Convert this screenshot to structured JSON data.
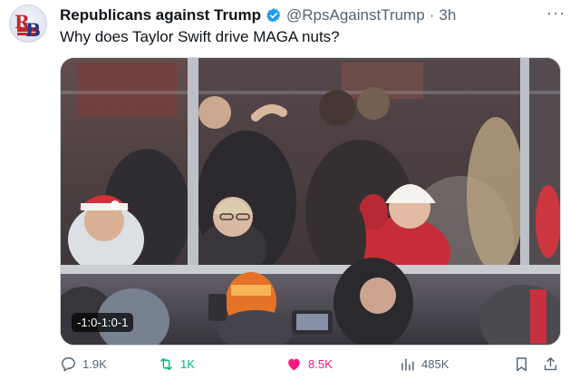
{
  "author": {
    "display_name": "Republicans against Trump",
    "handle": "@RpsAgainstTrump",
    "separator": "·",
    "time": "3h",
    "avatar_letters": "RB"
  },
  "tweet": {
    "text": "Why does Taylor Swift drive MAGA nuts?"
  },
  "media": {
    "video_time": "-1:0-1:0-1"
  },
  "actions": {
    "replies": "1.9K",
    "retweets": "1K",
    "likes": "8.5K",
    "views": "485K"
  },
  "colors": {
    "verified": "#1d9bf0",
    "retweet": "#00ba7c",
    "like": "#f91880",
    "muted": "#536471"
  },
  "icons": [
    "verified-badge-icon",
    "more-icon",
    "reply-icon",
    "retweet-icon",
    "heart-icon",
    "views-icon",
    "bookmark-icon",
    "share-icon"
  ]
}
